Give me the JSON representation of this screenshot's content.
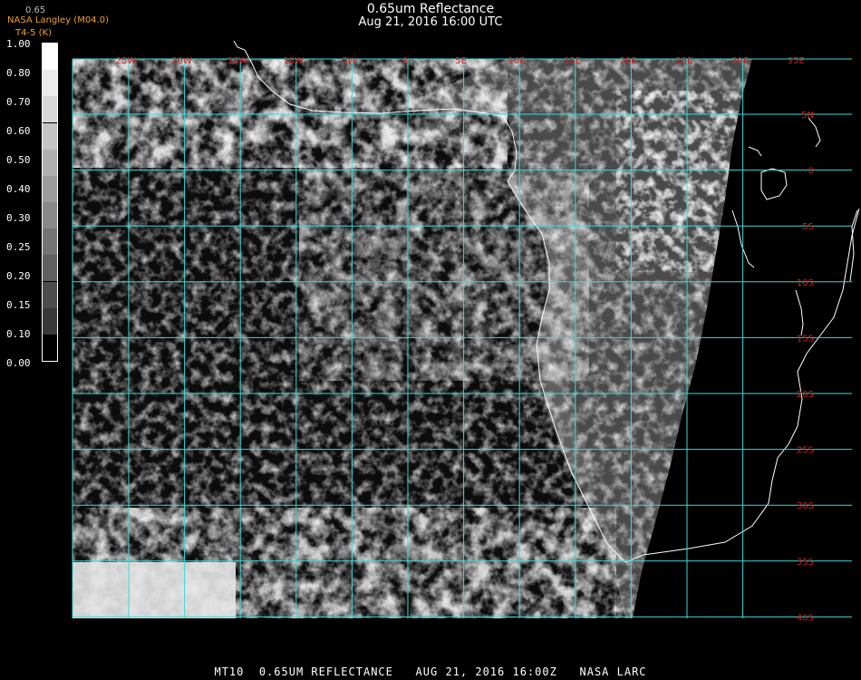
{
  "header": {
    "title": "0.65um Reflectance",
    "subtitle": "Aug 21, 2016 16:00 UTC",
    "credit_top": "0.65",
    "credit_line1": "NASA Langley (M04.0)",
    "credit_line2": "T4-5 (K)"
  },
  "colorbar": {
    "labels": [
      "1.00",
      "0.80",
      "0.70",
      "0.60",
      "0.50",
      "0.40",
      "0.30",
      "0.25",
      "0.20",
      "0.15",
      "0.10",
      "0.00"
    ],
    "grays": [
      "#ffffff",
      "#ececec",
      "#d8d8d8",
      "#c4c4c4",
      "#b0b0b0",
      "#9c9c9c",
      "#888888",
      "#747474",
      "#606060",
      "#4c4c4c",
      "#383838",
      "#000000"
    ]
  },
  "map": {
    "lon_labels": [
      "25W",
      "20W",
      "15W",
      "10W",
      "5W",
      "0",
      "5E",
      "10E",
      "15E",
      "20E",
      "25E",
      "30E",
      "35E"
    ],
    "lat_labels": [
      "5N",
      "0",
      "5S",
      "10S",
      "15S",
      "20S",
      "25S",
      "30S",
      "35S",
      "40S"
    ],
    "grid_color": "#3ed8d8",
    "label_color": "#cc2222",
    "coast_color": "#ffffff"
  },
  "footer": {
    "text": "MT10  0.65UM REFLECTANCE   AUG 21, 2016 16:00Z   NASA LARC"
  }
}
